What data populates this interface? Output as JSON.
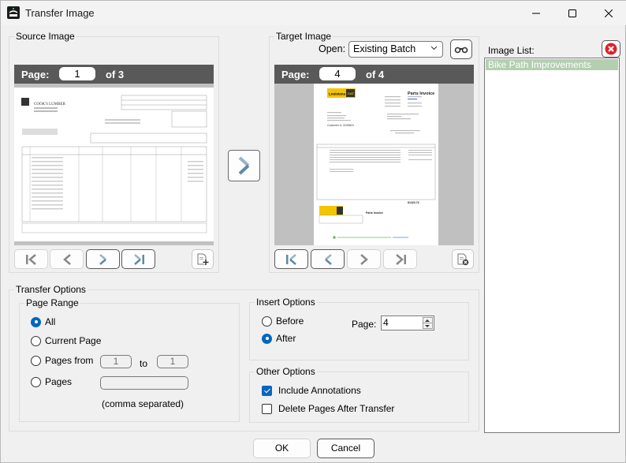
{
  "window": {
    "title": "Transfer Image",
    "app_icon": "spc-logo-icon",
    "controls": [
      "minimize-icon",
      "maximize-icon",
      "close-icon"
    ]
  },
  "source": {
    "group_label": "Source Image",
    "page_label": "Page:",
    "page_value": "1",
    "page_of": "of 3",
    "document": {
      "company": "COOK'S LUMBER",
      "type": "lumber invoice"
    },
    "nav": {
      "first": "first-page-icon",
      "prev": "previous-page-icon",
      "next": "next-page-icon",
      "last": "last-page-icon"
    },
    "add_page_icon": "add-page-icon"
  },
  "transfer_button_icon": "chevron-right-icon",
  "target": {
    "group_label": "Target Image",
    "open_label": "Open:",
    "open_value": "Existing Batch",
    "page_label": "Page:",
    "page_value": "4",
    "page_of": "of 4",
    "document": {
      "brand": "Louisiana CAT",
      "title": "Parts Invoice",
      "total": "$1423.74",
      "customer": "Customer #: 3105815"
    },
    "delete_page_icon": "delete-page-icon"
  },
  "image_list": {
    "label": "Image List:",
    "items": [
      "Bike Path Improvements"
    ],
    "selected_index": 0,
    "selected_color": "#b3cfb0"
  },
  "transfer_options": {
    "group_label": "Transfer Options",
    "page_range": {
      "label": "Page Range",
      "options": [
        "All",
        "Current Page",
        "Pages from",
        "Pages"
      ],
      "selected": "All",
      "from_value": "1",
      "to_label": "to",
      "to_value": "1",
      "pages_value": "",
      "pages_hint": "(comma separated)"
    },
    "insert_options": {
      "label": "Insert Options",
      "options": [
        "Before",
        "After"
      ],
      "selected": "After",
      "page_label": "Page:",
      "page_value": "4"
    },
    "other_options": {
      "label": "Other Options",
      "include_annotations": {
        "label": "Include Annotations",
        "checked": true
      },
      "delete_after": {
        "label": "Delete Pages After Transfer",
        "checked": false
      }
    }
  },
  "buttons": {
    "ok": "OK",
    "cancel": "Cancel"
  },
  "accent_color": "#0067c0"
}
